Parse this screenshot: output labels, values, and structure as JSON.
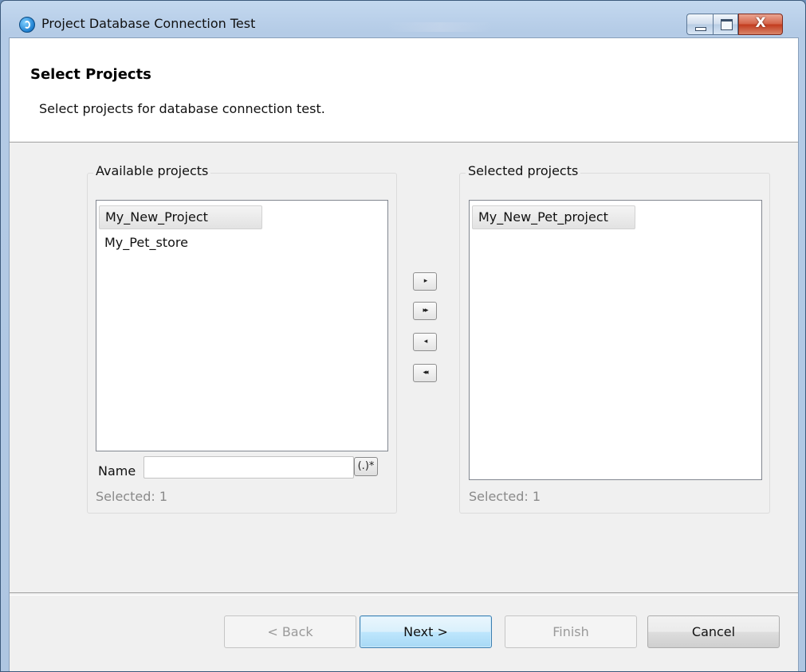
{
  "window": {
    "title": "Project Database Connection Test",
    "close_glyph": "X"
  },
  "header": {
    "title": "Select Projects",
    "description": "Select projects for database connection test."
  },
  "available": {
    "label": "Available projects",
    "items": [
      "My_New_Project",
      "My_Pet_store"
    ],
    "selected_item": "My_New_Project",
    "filter_label": "Name",
    "filter_value": "",
    "regex_button": "(.)*",
    "count_text": "Selected: 1"
  },
  "selected": {
    "label": "Selected projects",
    "items": [
      "My_New_Pet_project"
    ],
    "count_text": "Selected: 1"
  },
  "move_buttons": {
    "add": "▸",
    "add_all": "▸▸",
    "remove": "◂",
    "remove_all": "◂◂"
  },
  "buttons": {
    "back": "< Back",
    "next": "Next >",
    "finish": "Finish",
    "cancel": "Cancel"
  }
}
